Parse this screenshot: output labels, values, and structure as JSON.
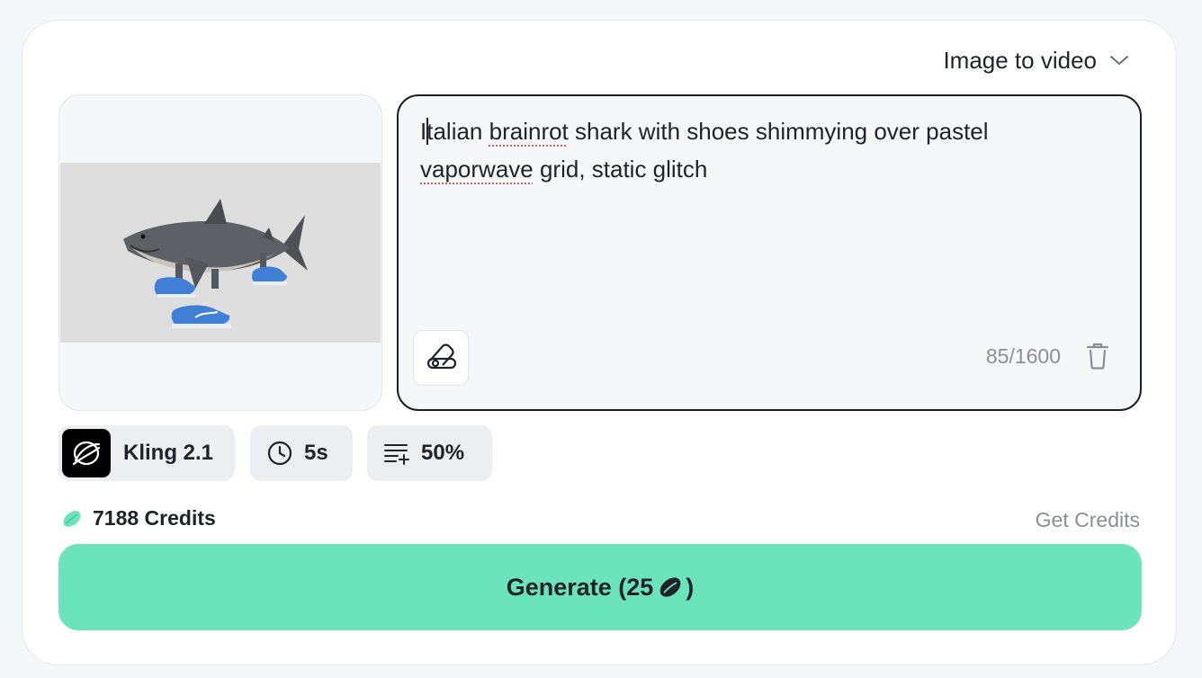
{
  "mode_select": {
    "label": "Image to video"
  },
  "image": {
    "alt": "Shark wearing blue sneakers"
  },
  "prompt": {
    "first_letter": "I",
    "text_part1": "talian ",
    "spell_word1": "brainrot",
    "text_part2": " shark with shoes shimmying over pastel\n",
    "spell_word2": "vaporwave",
    "text_part3": " grid, static glitch",
    "char_count": "85/1600"
  },
  "options": {
    "model": "Kling 2.1",
    "duration": "5s",
    "strength": "50%"
  },
  "credits": {
    "balance": "7188 Credits",
    "get_label": "Get Credits"
  },
  "generate": {
    "label_prefix": "Generate (25",
    "label_suffix": ")"
  },
  "colors": {
    "accent": "#6be3bb",
    "border_active": "#1c1f24",
    "muted_text": "#8a8f97"
  }
}
